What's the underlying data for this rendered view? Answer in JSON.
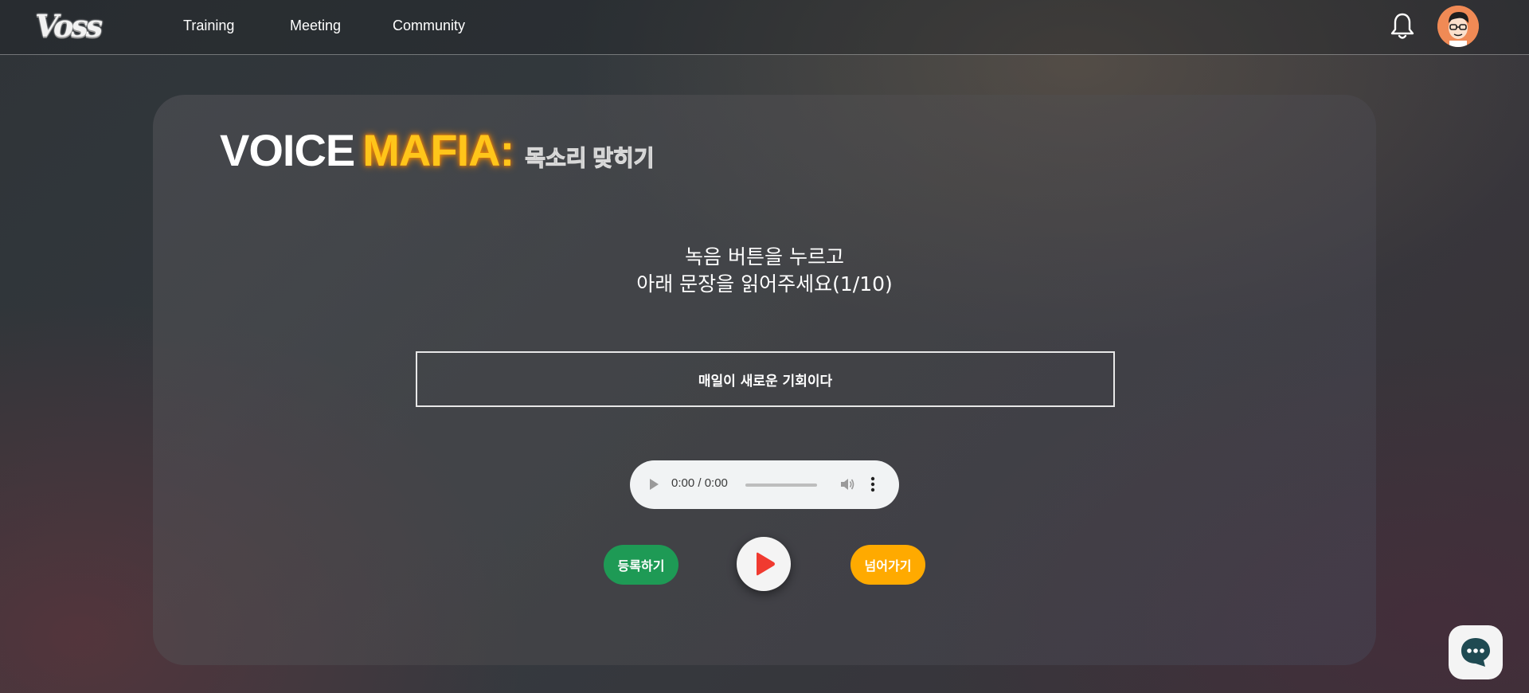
{
  "header": {
    "logo_text": "Voss",
    "nav": [
      {
        "label": "Training"
      },
      {
        "label": "Meeting"
      },
      {
        "label": "Community"
      }
    ]
  },
  "game": {
    "title_part1": "VOICE",
    "title_part2": "MAFIA:",
    "title_sub": "목소리 맞히기",
    "instruction_line1": "녹음 버튼을 누르고",
    "instruction_line2": "아래 문장을 읽어주세요(1/10)",
    "sentence": "매일이 새로운 기회이다",
    "audio_time": "0:00 / 0:00",
    "register_label": "등록하기",
    "skip_label": "넘어가기"
  },
  "colors": {
    "accent_yellow": "#ffc51a",
    "register_green": "#1e9a55",
    "skip_orange": "#ffaa00",
    "play_red": "#f03a30"
  },
  "icons": [
    "bell-icon",
    "avatar",
    "play-icon",
    "volume-icon",
    "more-vert-icon",
    "chat-icon"
  ]
}
